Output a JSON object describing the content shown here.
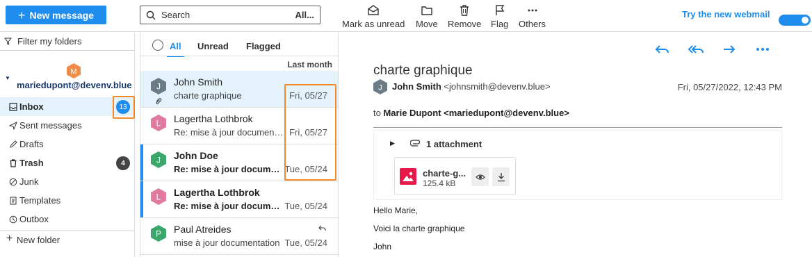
{
  "toolbar": {
    "new_message": "New message",
    "search_placeholder": "Search",
    "search_scope": "All...",
    "actions": {
      "mark_unread": "Mark as unread",
      "move": "Move",
      "remove": "Remove",
      "flag": "Flag",
      "others": "Others"
    },
    "try_webmail": "Try the new webmail",
    "accent": "#1f8ded"
  },
  "sidebar": {
    "filter": "Filter my folders",
    "account": {
      "initial": "M",
      "email": "mariedupont@devenv.blue",
      "avatar_color": "#f08c4a"
    },
    "folders": [
      {
        "label": "Inbox",
        "badge": "13"
      },
      {
        "label": "Sent messages"
      },
      {
        "label": "Drafts"
      },
      {
        "label": "Trash",
        "badge": "4"
      },
      {
        "label": "Junk"
      },
      {
        "label": "Templates"
      },
      {
        "label": "Outbox"
      }
    ],
    "new_folder": "New folder"
  },
  "list": {
    "tabs": [
      "All",
      "Unread",
      "Flagged"
    ],
    "group": "Last month",
    "messages": [
      {
        "initial": "J",
        "from": "John Smith",
        "subject": "charte graphique",
        "date": "Fri, 05/27",
        "avatar_color": "#6b7c86"
      },
      {
        "initial": "L",
        "from": "Lagertha Lothbrok",
        "subject": "Re: mise à jour documentation",
        "date": "Fri, 05/27",
        "avatar_color": "#e07a9f"
      },
      {
        "initial": "J",
        "from": "John Doe",
        "subject": "Re: mise à jour documentation",
        "date": "Tue, 05/24",
        "avatar_color": "#3aa86b"
      },
      {
        "initial": "L",
        "from": "Lagertha Lothbrok",
        "subject": "Re: mise à jour documentation",
        "date": "Tue, 05/24",
        "avatar_color": "#e07a9f"
      },
      {
        "initial": "P",
        "from": "Paul Atreides",
        "subject": "mise à jour documentation",
        "date": "Tue, 05/24",
        "avatar_color": "#3aa86b"
      }
    ]
  },
  "reader": {
    "subject": "charte graphique",
    "from_initial": "J",
    "from_name": "John Smith",
    "from_email": "<johnsmith@devenv.blue>",
    "date": "Fri, 05/27/2022, 12:43 PM",
    "to_prefix": "to",
    "to": "Marie Dupont <mariedupont@devenv.blue>",
    "attachments_label": "1 attachment",
    "attachment_name": "charte-g...",
    "attachment_size": "125.4 kB",
    "body": [
      "Hello Marie,",
      "Voici la charte graphique",
      "John"
    ]
  }
}
